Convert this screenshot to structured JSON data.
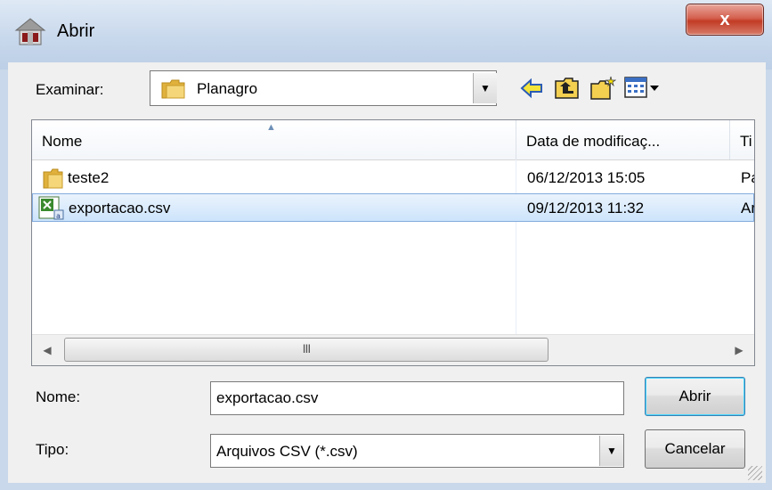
{
  "window": {
    "title": "Abrir",
    "close_label": "x"
  },
  "lookin": {
    "label": "Examinar:",
    "folder": "Planagro"
  },
  "toolbar": {
    "icons": [
      "back-icon",
      "up-folder-icon",
      "new-folder-icon",
      "view-menu-icon"
    ]
  },
  "list": {
    "columns": [
      "Nome",
      "Data de modificaç...",
      "Ti"
    ],
    "rows": [
      {
        "name": "teste2",
        "date": "06/12/2013 15:05",
        "type": "Pa",
        "icon": "folder-icon"
      },
      {
        "name": "exportacao.csv",
        "date": "09/12/2013 11:32",
        "type": "Ar",
        "icon": "csv-file-icon",
        "selected": true
      }
    ],
    "scroll_thumb_grip": "III"
  },
  "filename": {
    "label": "Nome:",
    "value": "exportacao.csv"
  },
  "filetype": {
    "label": "Tipo:",
    "value": "Arquivos CSV (*.csv)"
  },
  "buttons": {
    "open": "Abrir",
    "cancel": "Cancelar"
  },
  "colors": {
    "selection": "#cde4fb",
    "selection_border": "#84acdd",
    "close_button": "#c23b24",
    "titlebar": "#c8d8ec"
  }
}
